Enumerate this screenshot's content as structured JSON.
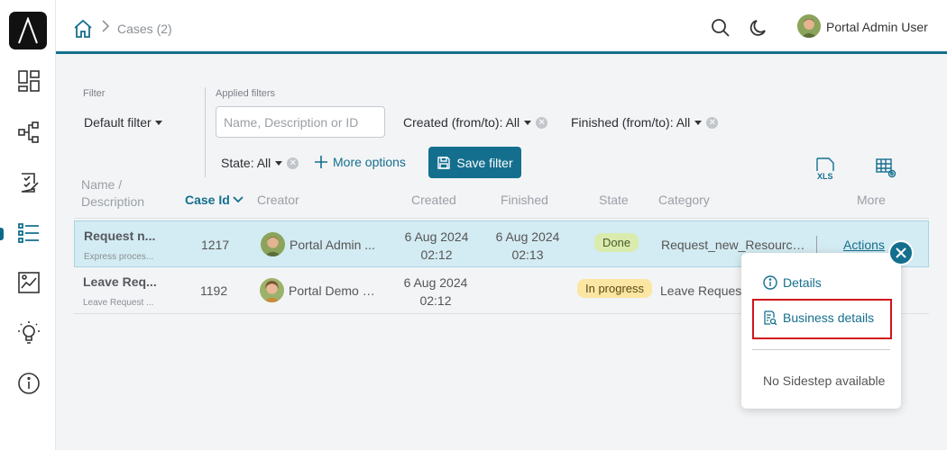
{
  "breadcrumb": {
    "current": "Cases (2)"
  },
  "user": {
    "name": "Portal Admin User"
  },
  "filter": {
    "label": "Filter",
    "value": "Default filter",
    "applied_label": "Applied filters",
    "search_placeholder": "Name, Description or ID",
    "chips": [
      {
        "label": "Created (from/to): All"
      },
      {
        "label": "Finished (from/to): All"
      },
      {
        "label": "State: All"
      }
    ],
    "more_options": "More options",
    "save_filter": "Save filter"
  },
  "table": {
    "headers": {
      "name_line1": "Name /",
      "name_line2": "Description",
      "case_id": "Case Id",
      "creator": "Creator",
      "created": "Created",
      "finished": "Finished",
      "state": "State",
      "category": "Category",
      "more": "More"
    },
    "rows": [
      {
        "name": "Request n...",
        "description": "Express proces...",
        "case_id": "1217",
        "creator": "Portal Admin ...",
        "created_date": "6 Aug 2024",
        "created_time": "02:12",
        "finished_date": "6 Aug 2024",
        "finished_time": "02:13",
        "state": "Done",
        "category": "Request_new_Resources...",
        "actions": "Actions"
      },
      {
        "name": "Leave Req...",
        "description": "Leave Request ...",
        "case_id": "1192",
        "creator": "Portal Demo U...",
        "created_date": "6 Aug 2024",
        "created_time": "02:12",
        "finished_date": "",
        "finished_time": "",
        "state": "In progress",
        "category": "Leave Request"
      }
    ]
  },
  "popup": {
    "details": "Details",
    "business_details": "Business details",
    "no_sidestep": "No Sidestep available"
  },
  "colors": {
    "accent": "#146f8e",
    "highlight": "#d0121b",
    "row_selected": "#d3ebf2"
  }
}
